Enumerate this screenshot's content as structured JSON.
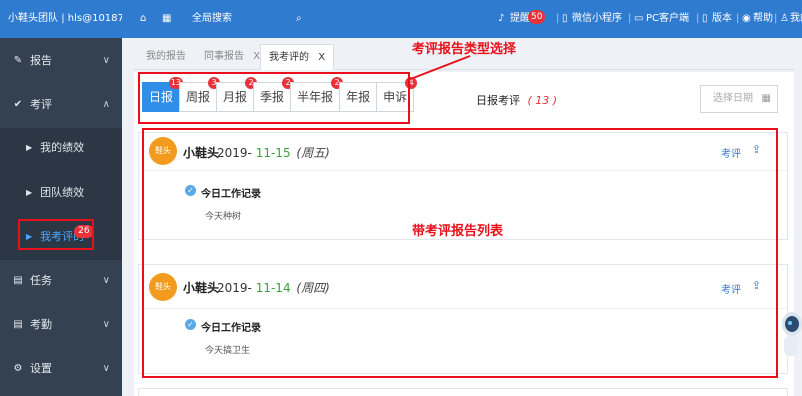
{
  "brand": {
    "team": "小鞋头团队",
    "account": "hls@10187"
  },
  "topbar": {
    "search_label": "全局搜索",
    "remind_label": "提醒",
    "remind_count": "50",
    "wechat_label": "微信小程序",
    "pc_label": "PC客户端",
    "version_label": "版本",
    "help_label": "帮助",
    "me_label": "我的"
  },
  "sidebar": {
    "report": "报告",
    "review": "考评",
    "my_perf": "我的绩效",
    "team_perf": "团队绩效",
    "my_review": "我考评的",
    "my_review_badge": "26",
    "task": "任务",
    "attendance": "考勤",
    "settings": "设置"
  },
  "tabs": [
    {
      "label": "我的报告"
    },
    {
      "label": "同事报告",
      "close": "X"
    },
    {
      "label": "我考评的",
      "close": "X"
    }
  ],
  "report_types": [
    {
      "label": "日报",
      "count": "13"
    },
    {
      "label": "周报",
      "count": "3"
    },
    {
      "label": "月报",
      "count": "2"
    },
    {
      "label": "季报",
      "count": "2"
    },
    {
      "label": "半年报",
      "count": "2"
    },
    {
      "label": "年报",
      "count": ""
    },
    {
      "label": "申诉",
      "count": "4"
    }
  ],
  "list_header": {
    "title": "日报考评",
    "count": "( 13 )",
    "date_placeholder": "选择日期"
  },
  "reports": [
    {
      "avatar": "鞋头",
      "name": "小鞋头",
      "year": "2019-",
      "md": "11-15",
      "weekday": "(周五)",
      "action": "考评",
      "record_title": "今日工作记录",
      "record_body": "今天种树"
    },
    {
      "avatar": "鞋头",
      "name": "小鞋头",
      "year": "2019-",
      "md": "11-14",
      "weekday": "(周四)",
      "action": "考评",
      "record_title": "今日工作记录",
      "record_body": "今天搞卫生"
    }
  ],
  "annotations": {
    "type_select": "考评报告类型选择",
    "list": "带考评报告列表"
  },
  "colors": {
    "primary": "#2f7bd0",
    "sidebar": "#344150",
    "annotation": "#e8101a",
    "badge": "#e8323a",
    "date_green": "#3aa33a"
  }
}
